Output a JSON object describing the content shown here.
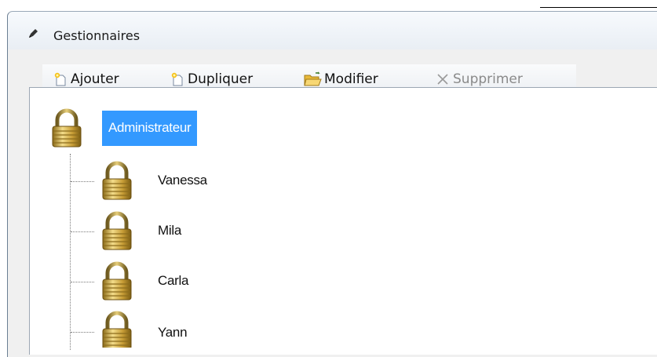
{
  "window": {
    "title": "Gestionnaires"
  },
  "toolbar": {
    "add_label": "Ajouter",
    "duplicate_label": "Dupliquer",
    "edit_label": "Modifier",
    "delete_label": "Supprimer"
  },
  "tree": {
    "root": {
      "label": "Administrateur",
      "selected": true
    },
    "children": [
      {
        "label": "Vanessa"
      },
      {
        "label": "Mila"
      },
      {
        "label": "Carla"
      },
      {
        "label": "Yann"
      }
    ]
  },
  "colors": {
    "selection": "#3399ff",
    "lock_gold": "#c9a33a"
  }
}
